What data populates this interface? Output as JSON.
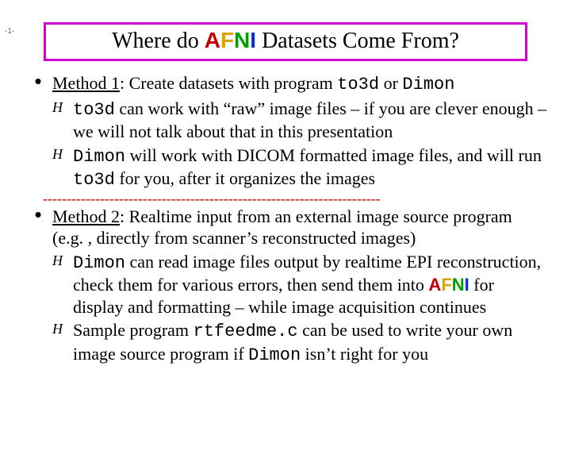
{
  "page_label": "-1-",
  "title": {
    "before": "Where do ",
    "afni_a": "A",
    "afni_f": "F",
    "afni_n": "N",
    "afni_i": "I",
    "after": " Datasets Come From?"
  },
  "m1": {
    "label": "Method 1",
    "rest_a": ": Create datasets with program ",
    "code1": "to3d",
    "rest_b": " or ",
    "code2": "Dimon"
  },
  "m1s1": {
    "code": "to3d",
    "rest": " can work with “raw” image files – if you are clever enough – we will not talk about that in this presentation"
  },
  "m1s2": {
    "code1": "Dimon",
    "mid1": " will work with DICOM formatted image files, and will run ",
    "code2": "to3d",
    "mid2": " for you, after it organizes the images"
  },
  "m2": {
    "label": "Method 2",
    "rest": ": Realtime input from an external image source program (e.g. , directly from scanner’s reconstructed images)"
  },
  "m2s1": {
    "code": "Dimon",
    "mid1": " can read image files output by realtime EPI reconstruction, check them for various errors, then send them into ",
    "afni_a": "A",
    "afni_f": "F",
    "afni_n": "N",
    "afni_i": "I",
    "mid2": " for display and formatting – while image acquisition continues"
  },
  "m2s2": {
    "pre": "Sample program ",
    "code1": "rtfeedme.c",
    "mid": " can be used to write your own image source program if ",
    "code2": "Dimon",
    "post": " isn’t right for you"
  },
  "marks": {
    "dot": "•",
    "hand": "H"
  },
  "separator": "-----------------------------------------------------------------------"
}
